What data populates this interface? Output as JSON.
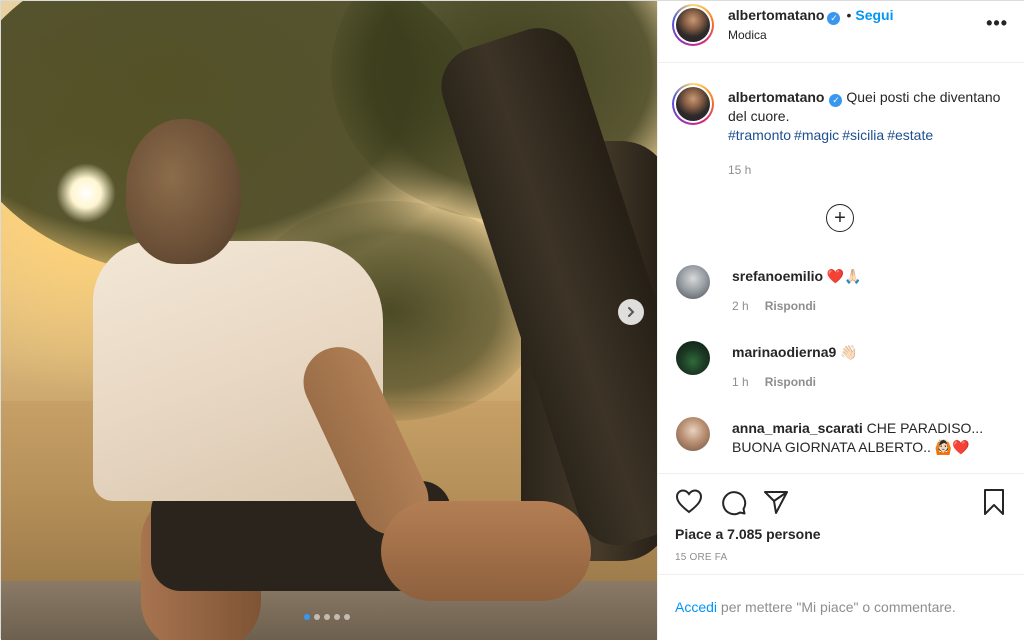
{
  "post": {
    "carousel": {
      "slide_count": 5,
      "active_index": 0
    }
  },
  "header": {
    "username": "albertomatano",
    "separator": "•",
    "follow_label": "Segui",
    "location": "Modica",
    "more_label": "•••"
  },
  "caption": {
    "username": "albertomatano",
    "text": "Quei posti che diventano del cuore.",
    "hashtags": [
      "#tramonto",
      "#magic",
      "#sicilia",
      "#estate"
    ],
    "time": "15 h"
  },
  "load_more_label": "+",
  "comments": [
    {
      "username": "srefanoemilio",
      "text": "❤️🙏🏻",
      "time": "2 h",
      "reply_label": "Rispondi"
    },
    {
      "username": "marinaodierna9",
      "text": "👋🏻",
      "time": "1 h",
      "reply_label": "Rispondi"
    },
    {
      "username": "anna_maria_scarati",
      "text": "CHE PARADISO... BUONA GIORNATA ALBERTO.. 🙆🏻❤️",
      "time": "",
      "reply_label": ""
    }
  ],
  "actions": {
    "likes": "Piace a 7.085 persone",
    "posted_ago": "15 ORE FA"
  },
  "login": {
    "link": "Accedi",
    "text": "per mettere \"Mi piace\" o commentare."
  },
  "icons": {
    "like": "heart-icon",
    "comment": "comment-icon",
    "share": "share-icon",
    "save": "bookmark-icon",
    "next": "chevron-right-icon",
    "verified": "verified-badge-icon"
  },
  "colors": {
    "link_blue": "#0095f6",
    "hashtag_blue": "#1d4f91",
    "muted": "#8e8e8e",
    "text": "#262626",
    "verified": "#3897f0"
  }
}
